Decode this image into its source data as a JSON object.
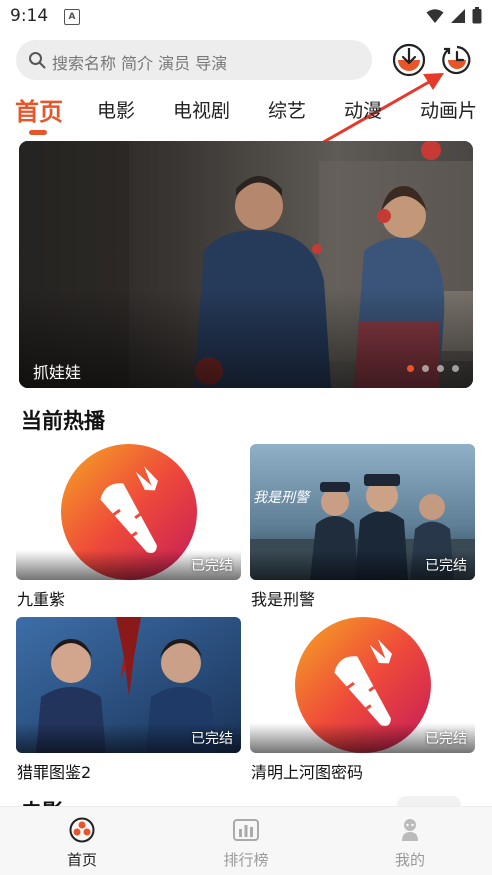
{
  "status_bar": {
    "time": "9:14",
    "notification_glyph": "A"
  },
  "search": {
    "placeholder": "搜索名称 简介 演员 导演"
  },
  "header_icons": [
    "download-icon",
    "history-icon"
  ],
  "tabs": [
    {
      "label": "首页",
      "active": true
    },
    {
      "label": "电影"
    },
    {
      "label": "电视剧"
    },
    {
      "label": "综艺"
    },
    {
      "label": "动漫"
    },
    {
      "label": "动画片"
    }
  ],
  "banner": {
    "title": "抓娃娃",
    "slide_count": 4,
    "active_slide": 1
  },
  "hot_section": {
    "title": "当前热播",
    "items": [
      {
        "title": "九重紫",
        "badge": "已完结",
        "thumb": "carrot-logo"
      },
      {
        "title": "我是刑警",
        "badge": "已完结",
        "thumb": "poster"
      },
      {
        "title": "猎罪图鉴2",
        "badge": "已完结",
        "thumb": "poster"
      },
      {
        "title": "清明上河图密码",
        "badge": "已完结",
        "thumb": "carrot-logo"
      }
    ]
  },
  "next_section": {
    "title": "电影"
  },
  "bottom_nav": [
    {
      "label": "首页",
      "icon": "home-icon",
      "active": true
    },
    {
      "label": "排行榜",
      "icon": "ranking-icon"
    },
    {
      "label": "我的",
      "icon": "profile-icon"
    }
  ],
  "colors": {
    "accent": "#e8552b",
    "background": "#ffffff",
    "search_bg": "#ededed"
  }
}
